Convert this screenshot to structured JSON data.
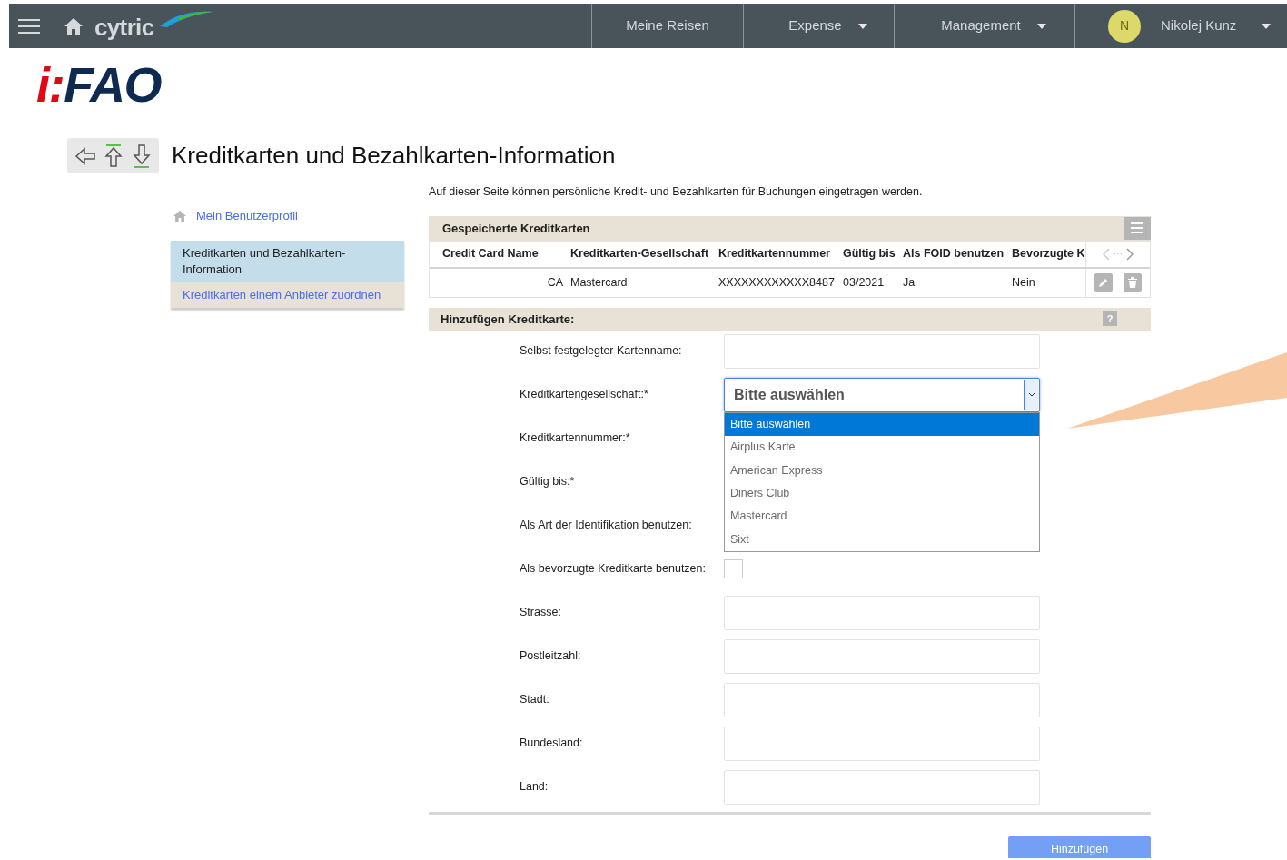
{
  "topbar": {
    "brand": "cytric",
    "nav": [
      {
        "label": "Meine Reisen",
        "dropdown": false
      },
      {
        "label": "Expense",
        "dropdown": true
      },
      {
        "label": "Management",
        "dropdown": true
      }
    ],
    "user": {
      "initial": "N",
      "name": "Nikolej Kunz"
    }
  },
  "logo": {
    "prefix": "i:",
    "name": "FAO"
  },
  "page_title": "Kreditkarten und Bezahlkarten-Information",
  "sidebar": {
    "home_link": "Mein Benutzerprofil",
    "items": [
      {
        "label": "Kreditkarten und Bezahlkarten-Information",
        "selected": true
      },
      {
        "label": "Kreditkarten einem Anbieter zuordnen",
        "selected": false
      }
    ]
  },
  "intro": "Auf dieser Seite können persönliche Kredit- und Bezahlkarten für Buchungen eingetragen werden.",
  "saved_cards": {
    "title": "Gespeicherte Kreditkarten",
    "columns": [
      "Credit Card Name",
      "Kreditkarten-Gesellschaft",
      "Kreditkartennummer",
      "Gültig bis",
      "Als FOID benutzen",
      "Bevorzugte K"
    ],
    "pager": "···",
    "rows": [
      [
        "CA",
        "Mastercard",
        "XXXXXXXXXXXX8487",
        "03/2021",
        "Ja",
        "Nein"
      ]
    ]
  },
  "add_card": {
    "title": "Hinzufügen Kreditkarte:",
    "help": "?",
    "fields": [
      {
        "label": "Selbst festgelegter Kartenname:",
        "kind": "text"
      },
      {
        "label": "Kreditkartengesellschaft:*",
        "kind": "select",
        "value": "Bitte auswählen",
        "expanded": true,
        "options": [
          {
            "label": "Bitte auswählen",
            "selected": true
          },
          {
            "label": "Airplus Karte",
            "selected": false
          },
          {
            "label": "American Express",
            "selected": false
          },
          {
            "label": "Diners Club",
            "selected": false
          },
          {
            "label": "Mastercard",
            "selected": false
          },
          {
            "label": "Sixt",
            "selected": false
          }
        ]
      },
      {
        "label": "Kreditkartennummer:*",
        "kind": "covered"
      },
      {
        "label": "Gültig bis:*",
        "kind": "covered"
      },
      {
        "label": "Als Art der Identifikation benutzen:",
        "kind": "covered"
      },
      {
        "label": "Als bevorzugte Kreditkarte benutzen:",
        "kind": "checkbox",
        "checked": false
      },
      {
        "label": "Strasse:",
        "kind": "text"
      },
      {
        "label": "Postleitzahl:",
        "kind": "text"
      },
      {
        "label": "Stadt:",
        "kind": "text"
      },
      {
        "label": "Bundesland:",
        "kind": "text"
      },
      {
        "label": "Land:",
        "kind": "text"
      }
    ],
    "submit": "Hinzufügen"
  }
}
